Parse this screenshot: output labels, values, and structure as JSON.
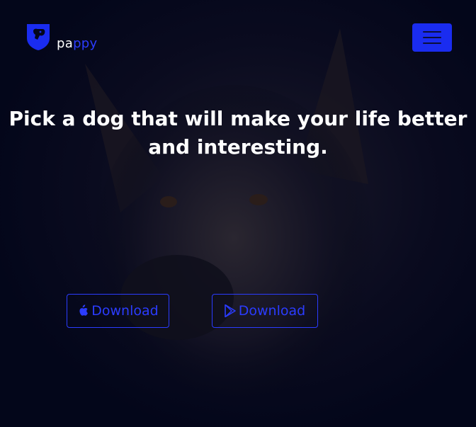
{
  "brand": {
    "name_part1": "pa",
    "name_part2": "ppy"
  },
  "header": {
    "menu_icon": "hamburger-icon"
  },
  "hero": {
    "headline": "Pick a dog that will make your life better and interesting."
  },
  "downloads": [
    {
      "label": "Download",
      "icon": "apple-icon"
    },
    {
      "label": "Download",
      "icon": "google-play-icon"
    }
  ],
  "colors": {
    "accent": "#1a2cf0",
    "background": "#03061a",
    "text": "#ffffff"
  }
}
